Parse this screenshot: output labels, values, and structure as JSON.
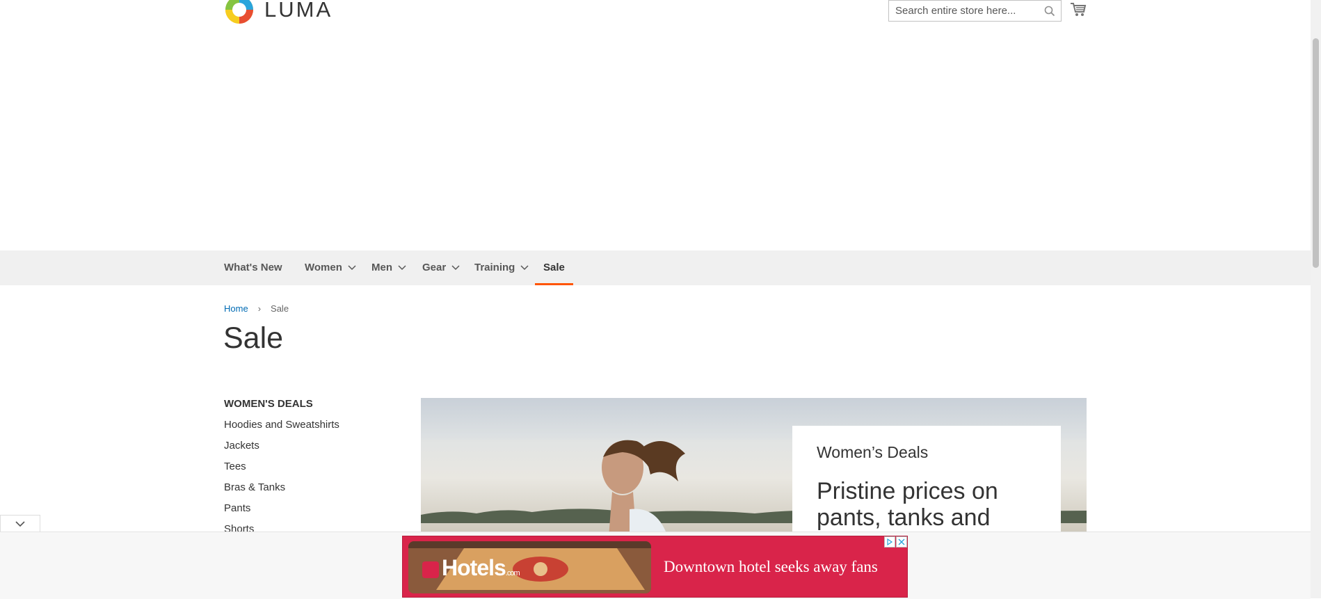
{
  "header": {
    "logo_text": "LUMA",
    "search": {
      "placeholder": "Search entire store here..."
    }
  },
  "nav": {
    "items": [
      {
        "label": "What's New",
        "has_dropdown": false
      },
      {
        "label": "Women",
        "has_dropdown": true
      },
      {
        "label": "Men",
        "has_dropdown": true
      },
      {
        "label": "Gear",
        "has_dropdown": true
      },
      {
        "label": "Training",
        "has_dropdown": true
      },
      {
        "label": "Sale",
        "has_dropdown": false,
        "active": true
      }
    ]
  },
  "breadcrumb": {
    "home": "Home",
    "current": "Sale"
  },
  "page_title": "Sale",
  "sidebar": {
    "title": "WOMEN'S DEALS",
    "links": [
      "Hoodies and Sweatshirts",
      "Jackets",
      "Tees",
      "Bras & Tanks",
      "Pants",
      "Shorts"
    ]
  },
  "hero": {
    "subtitle": "Women’s Deals",
    "headline": "Pristine prices on pants, tanks and"
  },
  "ad": {
    "brand": "Hotels",
    "brand_suffix": ".com",
    "text": "Downtown hotel seeks away fans",
    "background": "#d9244a"
  },
  "colors": {
    "accent": "#ff5501",
    "link": "#006bb4",
    "nav_bg": "#f0f0f0"
  }
}
